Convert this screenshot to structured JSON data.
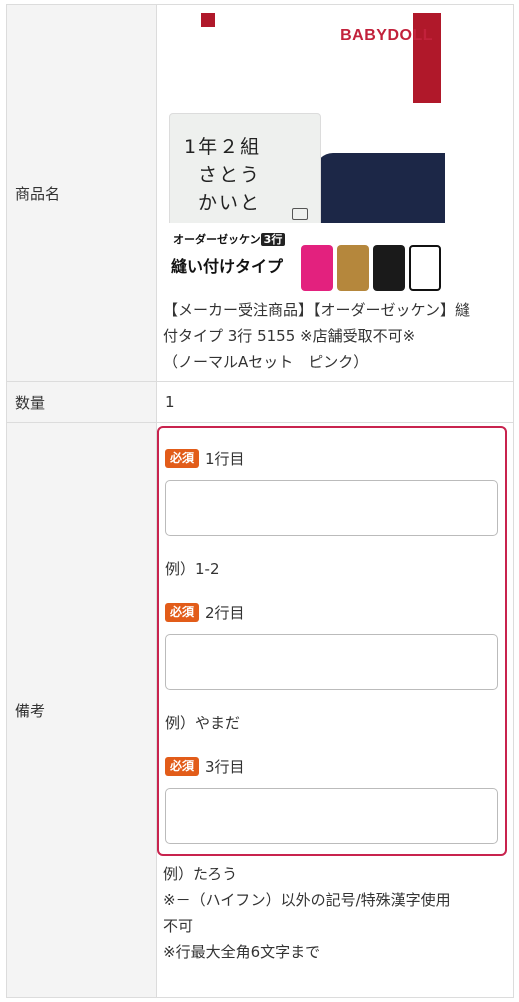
{
  "table": {
    "rows": [
      {
        "label": "商品名"
      },
      {
        "label": "数量"
      },
      {
        "label": "備考"
      }
    ]
  },
  "product": {
    "image": {
      "logo_text": "BABYDOLL",
      "tag_lines": [
        "1年２組",
        "さとう",
        "かいと"
      ],
      "banner_line1": "オーダーゼッケン",
      "banner_badge": "3行",
      "banner_line2": "縫い付けタイプ"
    },
    "name_lines": [
      "【メーカー受注商品】【オーダーゼッケン】縫",
      "付タイプ 3行 5155 ※店舗受取不可※",
      "（ノーマルAセット　ピンク）"
    ]
  },
  "quantity": {
    "value": "1"
  },
  "notes": {
    "required_badge": "必須",
    "fields": [
      {
        "label": "1行目",
        "value": "",
        "example": "例）1-2"
      },
      {
        "label": "2行目",
        "value": "",
        "example": "例）やまだ"
      },
      {
        "label": "3行目",
        "value": "",
        "example": "例）たろう"
      }
    ],
    "note_lines": [
      "※－（ハイフン）以外の記号/特殊漢字使用",
      "不可",
      "※行最大全角6文字まで"
    ]
  },
  "colors": {
    "required_badge": "#e25c19",
    "highlight_border": "#c8234e",
    "label_bg": "#f4f4f4"
  }
}
